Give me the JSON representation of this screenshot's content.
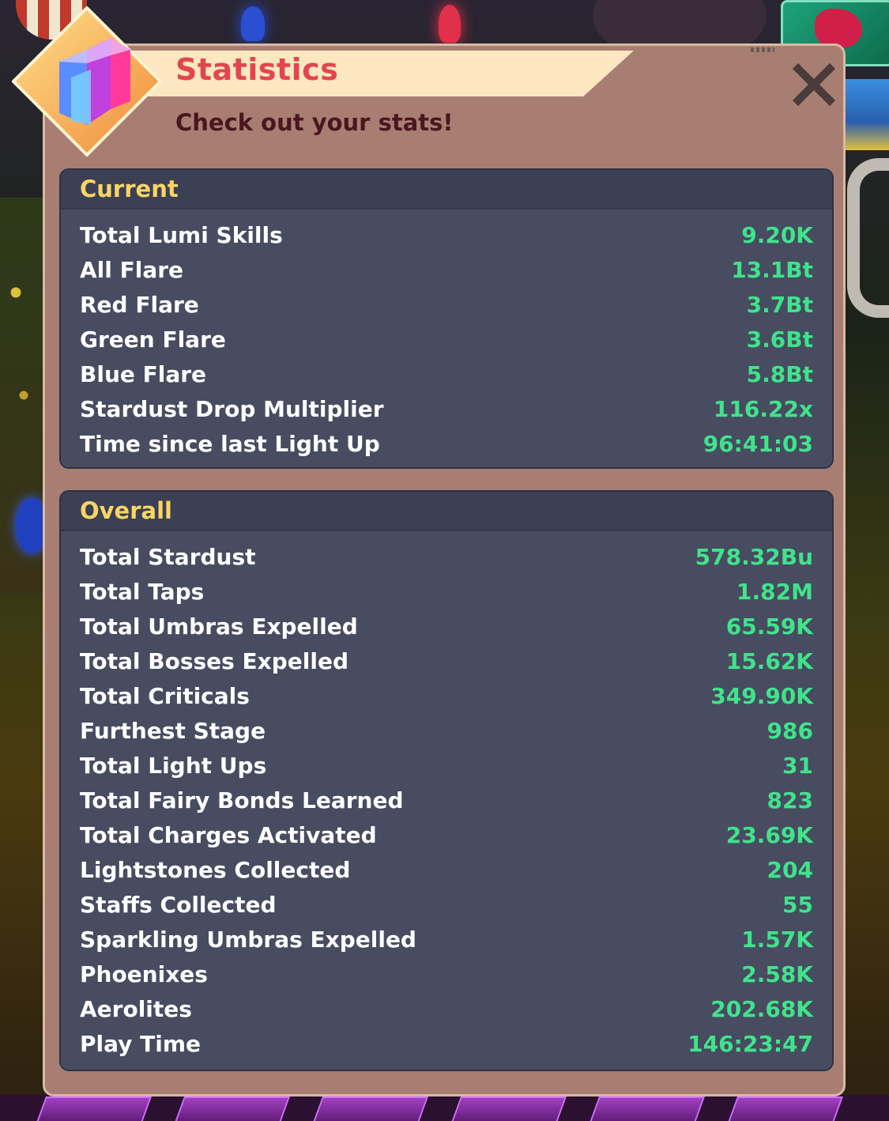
{
  "dialog": {
    "title": "Statistics",
    "subtitle": "Check out your stats!",
    "close_icon": "close-icon",
    "badge_icon": "stats-crystal-icon"
  },
  "current": {
    "header": "Current",
    "rows": [
      {
        "label": "Total Lumi Skills",
        "value": "9.20K"
      },
      {
        "label": "All Flare",
        "value": "13.1Bt"
      },
      {
        "label": "Red Flare",
        "value": "3.7Bt"
      },
      {
        "label": "Green Flare",
        "value": "3.6Bt"
      },
      {
        "label": "Blue Flare",
        "value": "5.8Bt"
      },
      {
        "label": "Stardust Drop Multiplier",
        "value": "116.22x"
      },
      {
        "label": "Time since last Light Up",
        "value": "96:41:03"
      }
    ]
  },
  "overall": {
    "header": "Overall",
    "rows": [
      {
        "label": "Total Stardust",
        "value": "578.32Bu"
      },
      {
        "label": "Total Taps",
        "value": "1.82M"
      },
      {
        "label": "Total Umbras Expelled",
        "value": "65.59K"
      },
      {
        "label": "Total Bosses Expelled",
        "value": "15.62K"
      },
      {
        "label": "Total Criticals",
        "value": "349.90K"
      },
      {
        "label": "Furthest Stage",
        "value": "986"
      },
      {
        "label": "Total Light Ups",
        "value": "31"
      },
      {
        "label": "Total Fairy Bonds Learned",
        "value": "823"
      },
      {
        "label": "Total Charges Activated",
        "value": "23.69K"
      },
      {
        "label": "Lightstones Collected",
        "value": "204"
      },
      {
        "label": "Staffs Collected",
        "value": "55"
      },
      {
        "label": "Sparkling Umbras Expelled",
        "value": "1.57K"
      },
      {
        "label": "Phoenixes",
        "value": "2.58K"
      },
      {
        "label": "Aerolites",
        "value": "202.68K"
      },
      {
        "label": "Play Time",
        "value": "146:23:47"
      }
    ]
  },
  "colors": {
    "title": "#e3454e",
    "subtitle": "#4a1620",
    "panel_header": "#fbd565",
    "label": "#ffffff",
    "value": "#40e38a",
    "panel_bg": "#474c61",
    "dialog_bg": "#a87e72"
  }
}
